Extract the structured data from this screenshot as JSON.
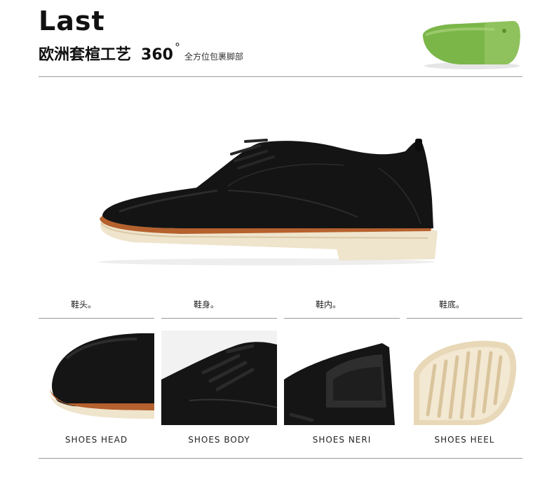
{
  "header": {
    "title": "Last",
    "subtitle_cn": "欧洲套楦工艺",
    "subtitle_num": "360",
    "degree": "°",
    "subtitle_small": "全方位包裹脚部"
  },
  "icons": {
    "last": "shoe-last-icon",
    "main": "shoe-main-image"
  },
  "sections": [
    {
      "cn": "鞋头。",
      "en": "SHOES HEAD"
    },
    {
      "cn": "鞋身。",
      "en": "SHOES BODY"
    },
    {
      "cn": "鞋内。",
      "en": "SHOES NERI"
    },
    {
      "cn": "鞋底。",
      "en": "SHOES HEEL"
    }
  ],
  "colors": {
    "leather": "#111111",
    "sole_cream": "#efe4cc",
    "welt_brown": "#b5612e",
    "last_green": "#7ab648"
  }
}
